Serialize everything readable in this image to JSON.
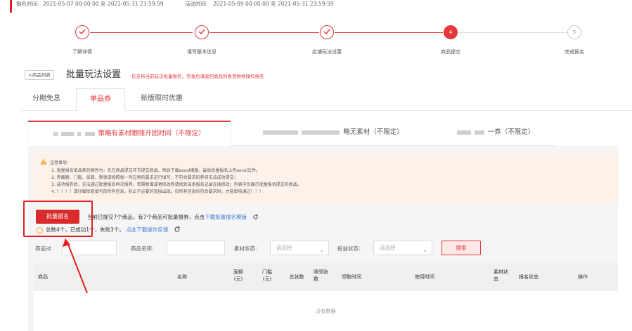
{
  "top_info": {
    "signup_label": "报名时间:",
    "signup_time": "2021-05-07 00:00:00 至 2021-05-31 23:59:59",
    "activity_label": "活动时间:",
    "activity_time": "2021-05-09 00:00:00 至 2021-05-31 23:59:59"
  },
  "steps": [
    {
      "label": "了解详情",
      "state": "done",
      "mark": ""
    },
    {
      "label": "填写基本信息",
      "state": "done",
      "mark": ""
    },
    {
      "label": "店铺玩法设置",
      "state": "done",
      "mark": ""
    },
    {
      "label": "商品提交",
      "state": "active",
      "mark": "4"
    },
    {
      "label": "完成报名",
      "state": "todo",
      "mark": "5"
    }
  ],
  "header": {
    "back_label": "<商品列表",
    "title": "批量玩法设置",
    "note": "仅支持当前玩法批量报名，完善后请返回商品列表页继续操作报名"
  },
  "tabs": [
    {
      "label": "分期免息",
      "active": false
    },
    {
      "label": "单品券",
      "active": true
    },
    {
      "label": "新版限时优惠",
      "active": false
    }
  ],
  "subtabs": [
    {
      "label": "策略有素材跟随开团时间（不限定）",
      "active": true
    },
    {
      "label": "略无素材（不限定）",
      "active": false
    },
    {
      "label": "一券（不限定）",
      "active": false
    }
  ],
  "notice": {
    "title": "注意事项:",
    "lines": [
      "1. 批量报名单品券的顺序为：先在商品提交环节提交商品，然后下载excel模版，最后批量报名上传excel文件。",
      "2. 券面额、门槛、张数、限领请按照每一列左侧的要求进行填写，不符合要求的券将无法成功提交；",
      "3. 成功报券后，无法通过批量报名再次报券，若需新增或者修改券请找到该条报名记录在线修改；列表中仅展示批量报名提交的商品。",
      "4. ！！！！请仔细检查填写的所有信息，防止不必要的资损出现。仅所有信息均符合要求时，才能审核通过！！！"
    ]
  },
  "batch": {
    "button_label": "批量报名",
    "status_prefix": "当前已提交7个商品，有7个商品可批量报券，点击",
    "download_link": "下载批量报名模版",
    "result_text": "总数4个，已成功1个，失败3个。",
    "feedback_link": "点此下载操作反馈"
  },
  "filters": {
    "product_id_label": "商品id:",
    "product_name_label": "商品名称:",
    "material_label": "素材状态:",
    "material_placeholder": "请选择",
    "rights_label": "权益状态:",
    "rights_placeholder": "请选择",
    "search_label": "搜索"
  },
  "table": {
    "columns": [
      "商品",
      "名称",
      "面额\n(元)",
      "门槛\n(元)",
      "总张数",
      "限领张\n数",
      "领取时间",
      "使用时间",
      "素材状\n态",
      "报名状态",
      "操作"
    ],
    "empty_text": "没有数据"
  },
  "colors": {
    "accent": "#e4393c",
    "notice_bg": "#fdf2ea",
    "link": "#3a7bd5"
  }
}
